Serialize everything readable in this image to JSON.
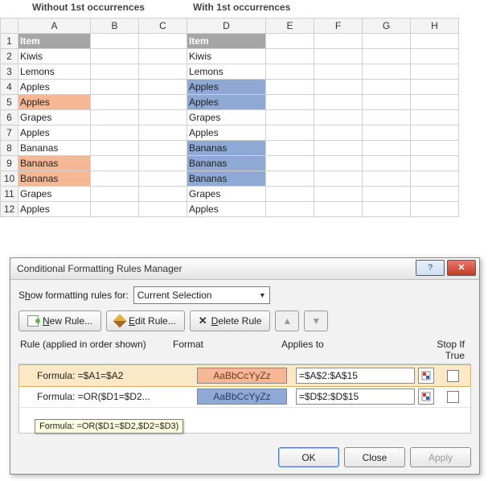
{
  "titles": {
    "left": "Without 1st occurrences",
    "right": "With 1st occurrences"
  },
  "columns": [
    "A",
    "B",
    "C",
    "D",
    "E",
    "F",
    "G",
    "H"
  ],
  "rows": [
    "1",
    "2",
    "3",
    "4",
    "5",
    "6",
    "7",
    "8",
    "9",
    "10",
    "11",
    "12"
  ],
  "header_label": "Item",
  "cells_a": [
    "Kiwis",
    "Lemons",
    "Apples",
    "Apples",
    "Grapes",
    "Apples",
    "Bananas",
    "Bananas",
    "Bananas",
    "Grapes",
    "Apples"
  ],
  "cells_d": [
    "Kiwis",
    "Lemons",
    "Apples",
    "Apples",
    "Grapes",
    "Apples",
    "Bananas",
    "Bananas",
    "Bananas",
    "Grapes",
    "Apples"
  ],
  "hl_a_rows": [
    5,
    9,
    10
  ],
  "hl_d_rows": [
    4,
    5,
    8,
    9,
    10
  ],
  "dialog": {
    "title": "Conditional Formatting Rules Manager",
    "show_label_pre": "S",
    "show_label_u": "h",
    "show_label_post": "ow formatting rules for:",
    "selection": "Current Selection",
    "buttons": {
      "new_u": "N",
      "new": "ew Rule...",
      "edit_u": "E",
      "edit": "dit Rule...",
      "del_u": "D",
      "del": "elete Rule"
    },
    "headers": {
      "rule": "Rule (applied in order shown)",
      "format": "Format",
      "applies": "Applies to",
      "stop": "Stop If True"
    },
    "rules": [
      {
        "formula": "Formula: =$A1=$A2",
        "applies": "=$A$2:$A$15",
        "swatch": "AaBbCcYyZz",
        "cls": "sw-a"
      },
      {
        "formula": "Formula: =OR($D1=$D2...",
        "applies": "=$D$2:$D$15",
        "swatch": "AaBbCcYyZz",
        "cls": "sw-d"
      }
    ],
    "tooltip": "Formula: =OR($D1=$D2,$D2=$D3)",
    "footer": {
      "ok": "OK",
      "close": "Close",
      "apply": "Apply"
    }
  }
}
